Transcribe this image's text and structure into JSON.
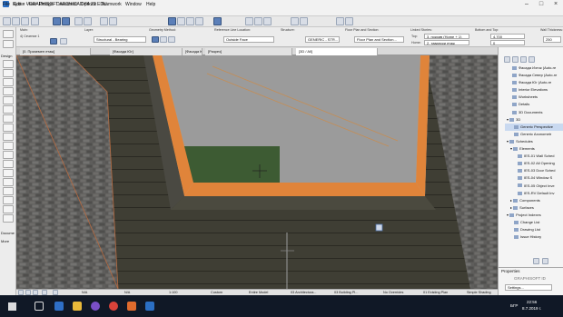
{
  "window": {
    "title": "Кухня - GRAPHISOFT ARCHICAD-64 22 EDU"
  },
  "menu": [
    "File",
    "Edit",
    "View",
    "Design",
    "Document",
    "Options",
    "Teamwork",
    "Window",
    "Help"
  ],
  "infobox": {
    "main_label": "Main:",
    "layer_label": "Layer:",
    "layer_value": "Structural - Bearing",
    "geometry_label": "Geometry Method:",
    "refline_label": "Reference Line Location:",
    "refline_value": "Outside Face",
    "structure_label": "Structure:",
    "structure_value": "GENERIC - STR...",
    "floorplan_label": "Floor Plan and Section:",
    "floorplan_value": "Floor Plan and Section...",
    "linked_label": "Linked Stories:",
    "top_label": "Top:",
    "top_value": "3. покрив (Home + 1)",
    "home_label": "Home:",
    "home_value": "2. тавански етаж",
    "bottom_label": "Bottom and Top:",
    "bottom_top": "4.700",
    "bottom_bottom": "0",
    "wall_label": "Wall Thickness:",
    "wall_value": "250",
    "story_value": "4) Сечение 1"
  },
  "tabs": [
    "[0. Приземен етаж]",
    "[Фасада Юг]",
    "[Фасада Юг]",
    "[Разрез]",
    "[3D / All]"
  ],
  "navigator": [
    "Фасада Изток (Auto-re",
    "Фасада Север (Auto-re",
    "Фасада Юг (Auto-re",
    "Interior Elevations",
    "Worksheets",
    "Details",
    "3D Documents",
    "3D",
    "Generic Perspective",
    "Generic Axonometr",
    "Schedules",
    "Elements",
    "IES-01 Wall Sched",
    "IES-02 All Opening",
    "IES-03 Door Sched",
    "IES-04 Window S",
    "IES-05 Object Inve",
    "IES-RV Default Inv",
    "Components",
    "Surfaces",
    "Project Indexes",
    "Change List",
    "Drawing List",
    "Issue History"
  ],
  "properties": {
    "label": "Properties",
    "settings": "Settings..."
  },
  "toolbox": {
    "design": "Design",
    "document": "Docume",
    "more": "More"
  },
  "status": {
    "na1": "N/A",
    "na2": "N/A",
    "scale": "1:100",
    "custom": "Custom",
    "model": "Entire Model",
    "arch": "03 Architectura...",
    "building": "03 Building Pl...",
    "override": "No Overrides",
    "existing": "01 Existing Plan",
    "shading": "Simple Shading"
  },
  "taskbar": {
    "lang": "БГР",
    "time": "22:56",
    "date": "8.7.2019 г."
  },
  "watermark": "GRAPHISOFT ID"
}
